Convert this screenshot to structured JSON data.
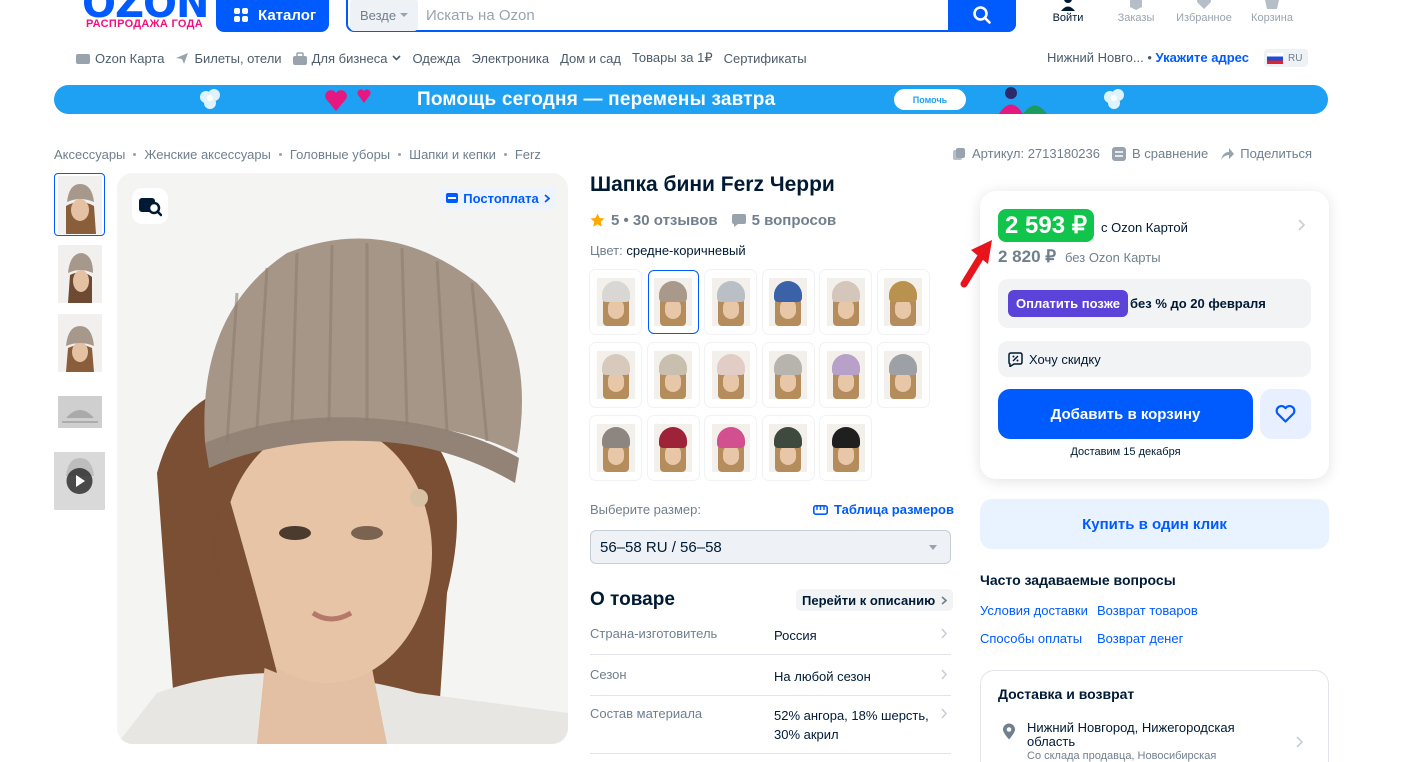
{
  "header": {
    "logo": "OZON",
    "logo_sub": "РАСПРОДАЖА ГОДА",
    "catalog_label": "Каталог",
    "search_scope": "Везде",
    "search_placeholder": "Искать на Ozon",
    "actions": [
      {
        "label": "Войти",
        "icon": "user-icon"
      },
      {
        "label": "Заказы",
        "icon": "box-icon"
      },
      {
        "label": "Избранное",
        "icon": "heart-icon"
      },
      {
        "label": "Корзина",
        "icon": "cart-icon"
      }
    ]
  },
  "nav": {
    "items": [
      {
        "label": "Ozon Карта",
        "icon": "card-icon"
      },
      {
        "label": "Билеты, отели",
        "icon": "plane-icon"
      },
      {
        "label": "Для бизнеса",
        "icon": "briefcase-icon"
      },
      {
        "label": "Одежда"
      },
      {
        "label": "Электроника"
      },
      {
        "label": "Дом и сад"
      },
      {
        "label": "Товары за 1₽"
      },
      {
        "label": "Сертификаты"
      }
    ],
    "city": "Нижний Новго...",
    "address_link": "Укажите адрес",
    "lang": "RU"
  },
  "banner": {
    "text": "Помощь сегодня — перемены завтра",
    "button": "Помочь"
  },
  "breadcrumb": [
    "Аксессуары",
    "Женские аксессуары",
    "Головные уборы",
    "Шапки и кепки",
    "Ferz"
  ],
  "meta": {
    "article": "Артикул: 2713180236",
    "compare": "В сравнение",
    "share": "Поделиться"
  },
  "gallery": {
    "postpay": "Постоплата"
  },
  "product": {
    "title": "Шапка бини Ferz Черри",
    "rating": "5 • 30 отзывов",
    "questions": "5 вопросов",
    "color_label": "Цвет:",
    "color_value": "средне-коричневый",
    "variant_colors": [
      "#d9d7d4",
      "#a8998a",
      "#b9bfc4",
      "#3b62a8",
      "#d5c6bb",
      "#b8924e",
      "#d8c9bd",
      "#c9bfae",
      "#e2ccc6",
      "#b7b4ae",
      "#b7a1c9",
      "#9da1a6",
      "#8d8580",
      "#9e2338",
      "#d2508f",
      "#3f4a3f",
      "#1f1f1f"
    ],
    "selected_variant": 1,
    "size_label": "Выберите размер:",
    "size_table": "Таблица размеров",
    "size_value": "56–58 RU / 56–58",
    "about_title": "О товаре",
    "goto_desc": "Перейти к описанию",
    "attributes": [
      {
        "key": "Страна-изготовитель",
        "value": "Россия"
      },
      {
        "key": "Сезон",
        "value": "На любой сезон"
      },
      {
        "key": "Состав материала",
        "value": "52% ангора, 18% шерсть, 30% акрил"
      }
    ]
  },
  "price": {
    "ozon_price": "2 593 ₽",
    "ozon_label": "с Ozon Картой",
    "regular_price": "2 820 ₽",
    "regular_label": "без Ozon Карты",
    "pay_later_badge": "Оплатить позже",
    "pay_later_text": "без % до 20 февраля",
    "want_discount": "Хочу скидку",
    "add_to_cart": "Добавить в корзину",
    "delivery": "Доставим 15 декабря",
    "buy_one_click": "Купить в один клик"
  },
  "faq": {
    "title": "Часто задаваемые вопросы",
    "links": [
      "Условия доставки",
      "Возврат товаров",
      "Способы оплаты",
      "Возврат денег"
    ]
  },
  "delivery_return": {
    "title": "Доставка и возврат",
    "address": "Нижний Новгород, Нижегородская область",
    "sub": "Со склада продавца, Новосибирская"
  },
  "colors": {
    "brand": "#005bff",
    "ozon_price_green": "#10c44c",
    "pay_later_purple": "#5b42d9",
    "sale_pink": "#f1117e",
    "banner_blue": "#1ea1f2"
  }
}
